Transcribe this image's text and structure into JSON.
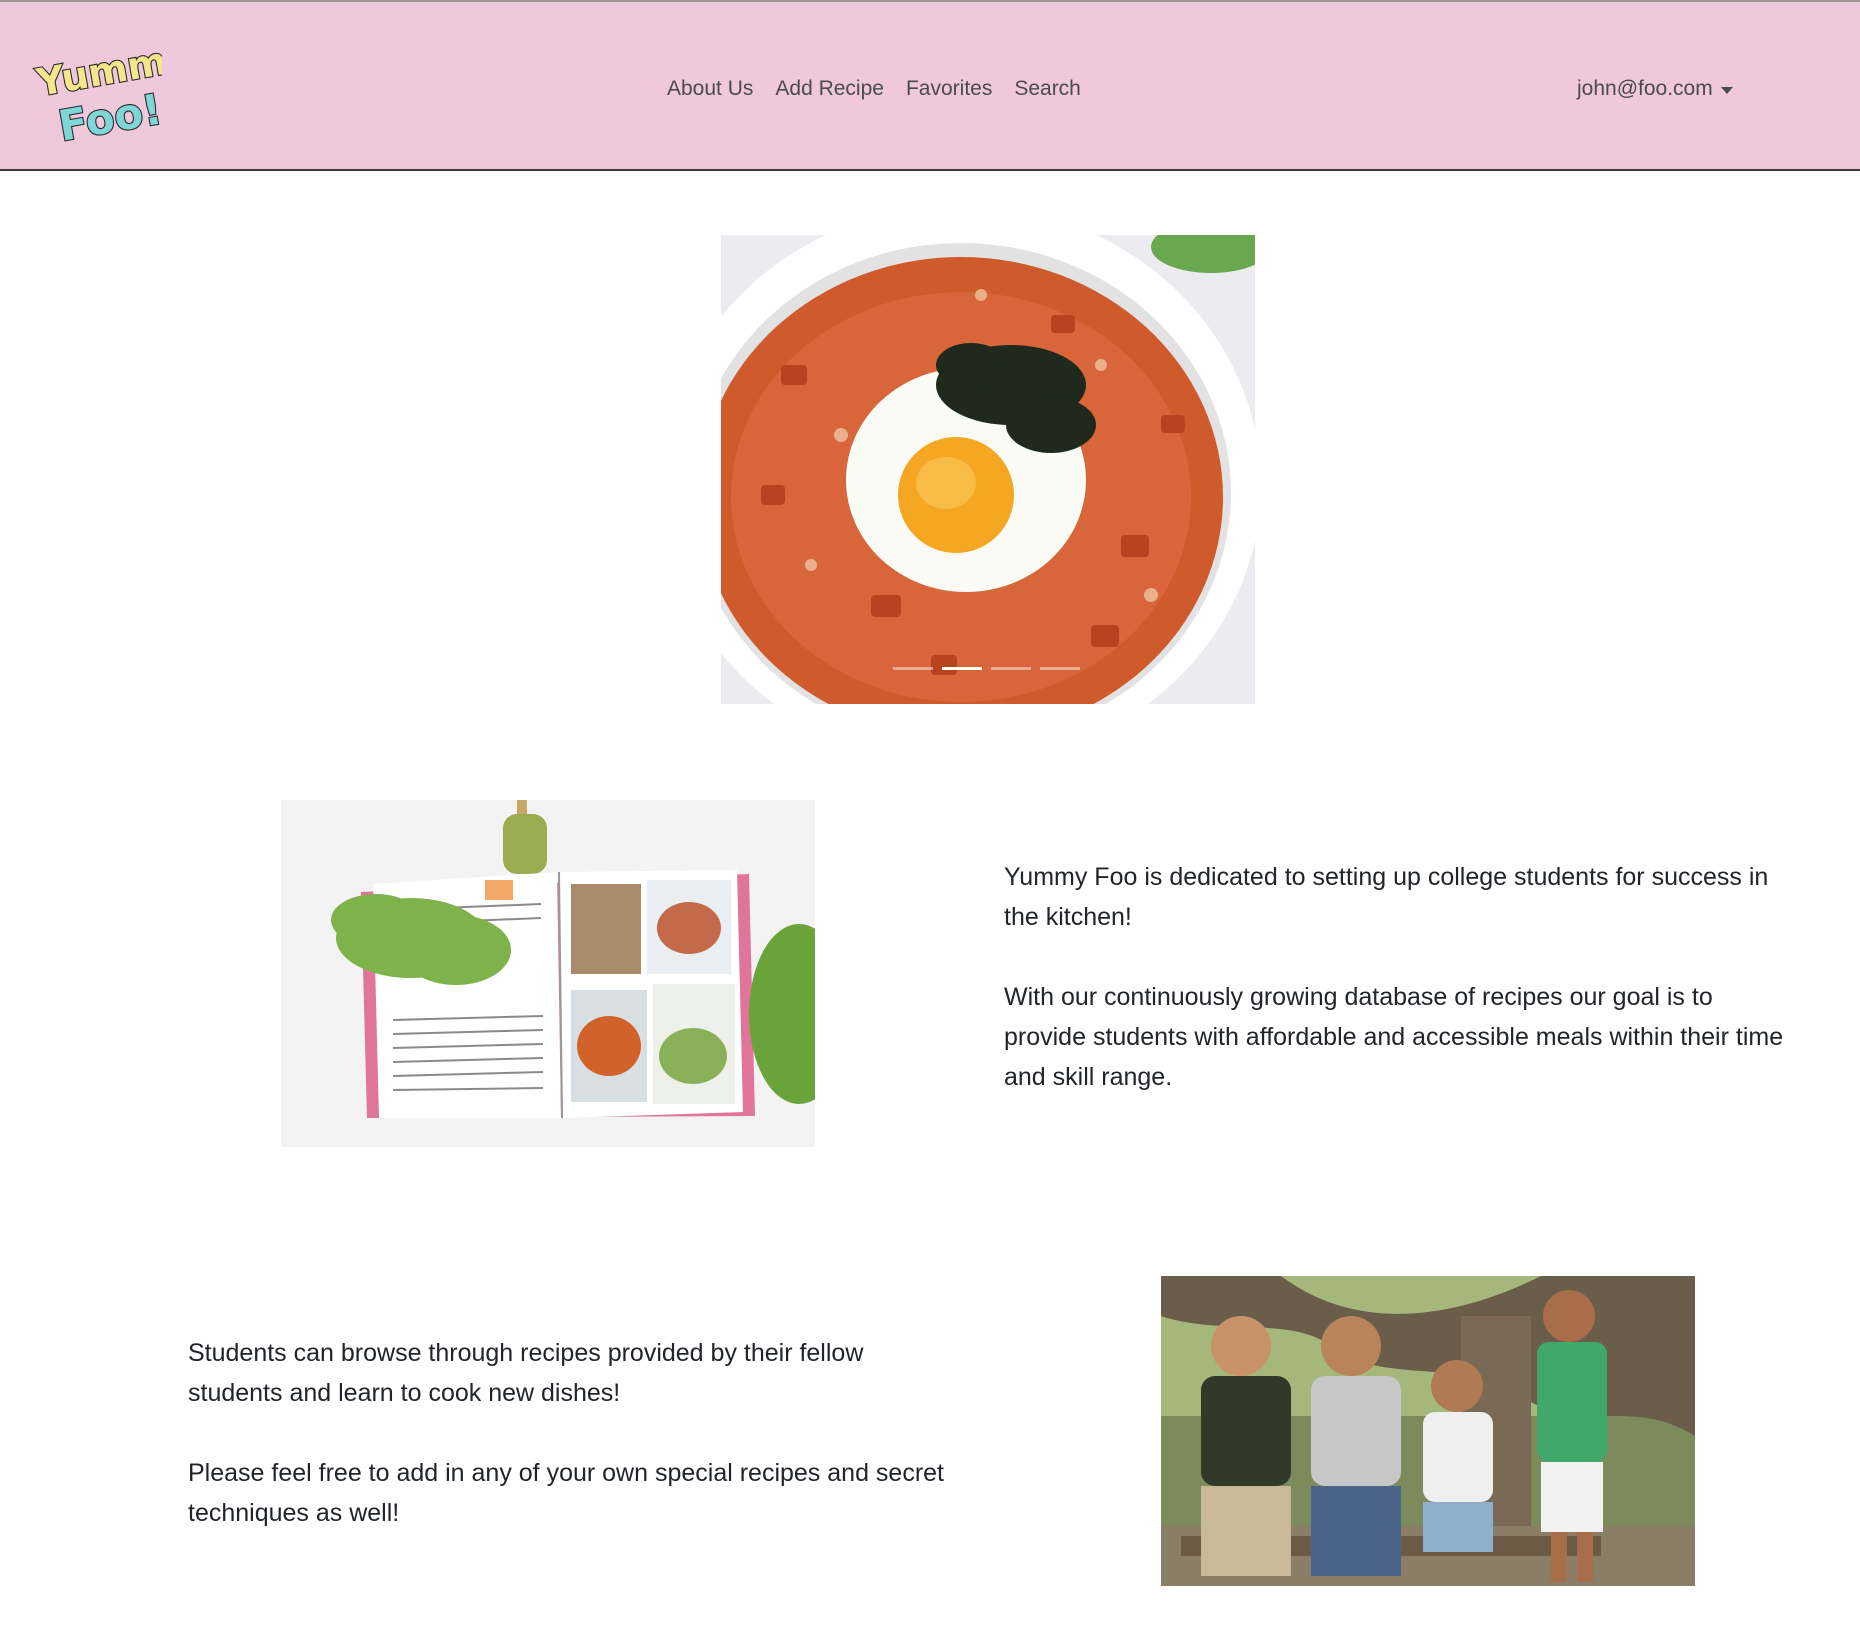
{
  "navbar": {
    "logo": {
      "line1": "Yummy",
      "line2": "Foo!"
    },
    "links": [
      {
        "label": "About Us"
      },
      {
        "label": "Add Recipe"
      },
      {
        "label": "Favorites"
      },
      {
        "label": "Search"
      }
    ],
    "user": {
      "email": "john@foo.com"
    }
  },
  "carousel": {
    "slide_count": 4,
    "active_index": 1
  },
  "about": {
    "paragraph1": "Yummy Foo is dedicated to setting up college students for success in the kitchen!",
    "paragraph2": "With our continuously growing database of recipes our goal is to provide students with affordable and accessible meals within their time and skill range."
  },
  "community": {
    "paragraph1": "Students can browse through recipes provided by their fellow students and learn to cook new dishes!",
    "paragraph2": "Please feel free to add in any of your own special recipes and secret techniques as well!"
  },
  "colors": {
    "navbar_bg": "#f0c8dc",
    "logo_yellow": "#f5e68c",
    "logo_teal": "#7fd6d6"
  }
}
